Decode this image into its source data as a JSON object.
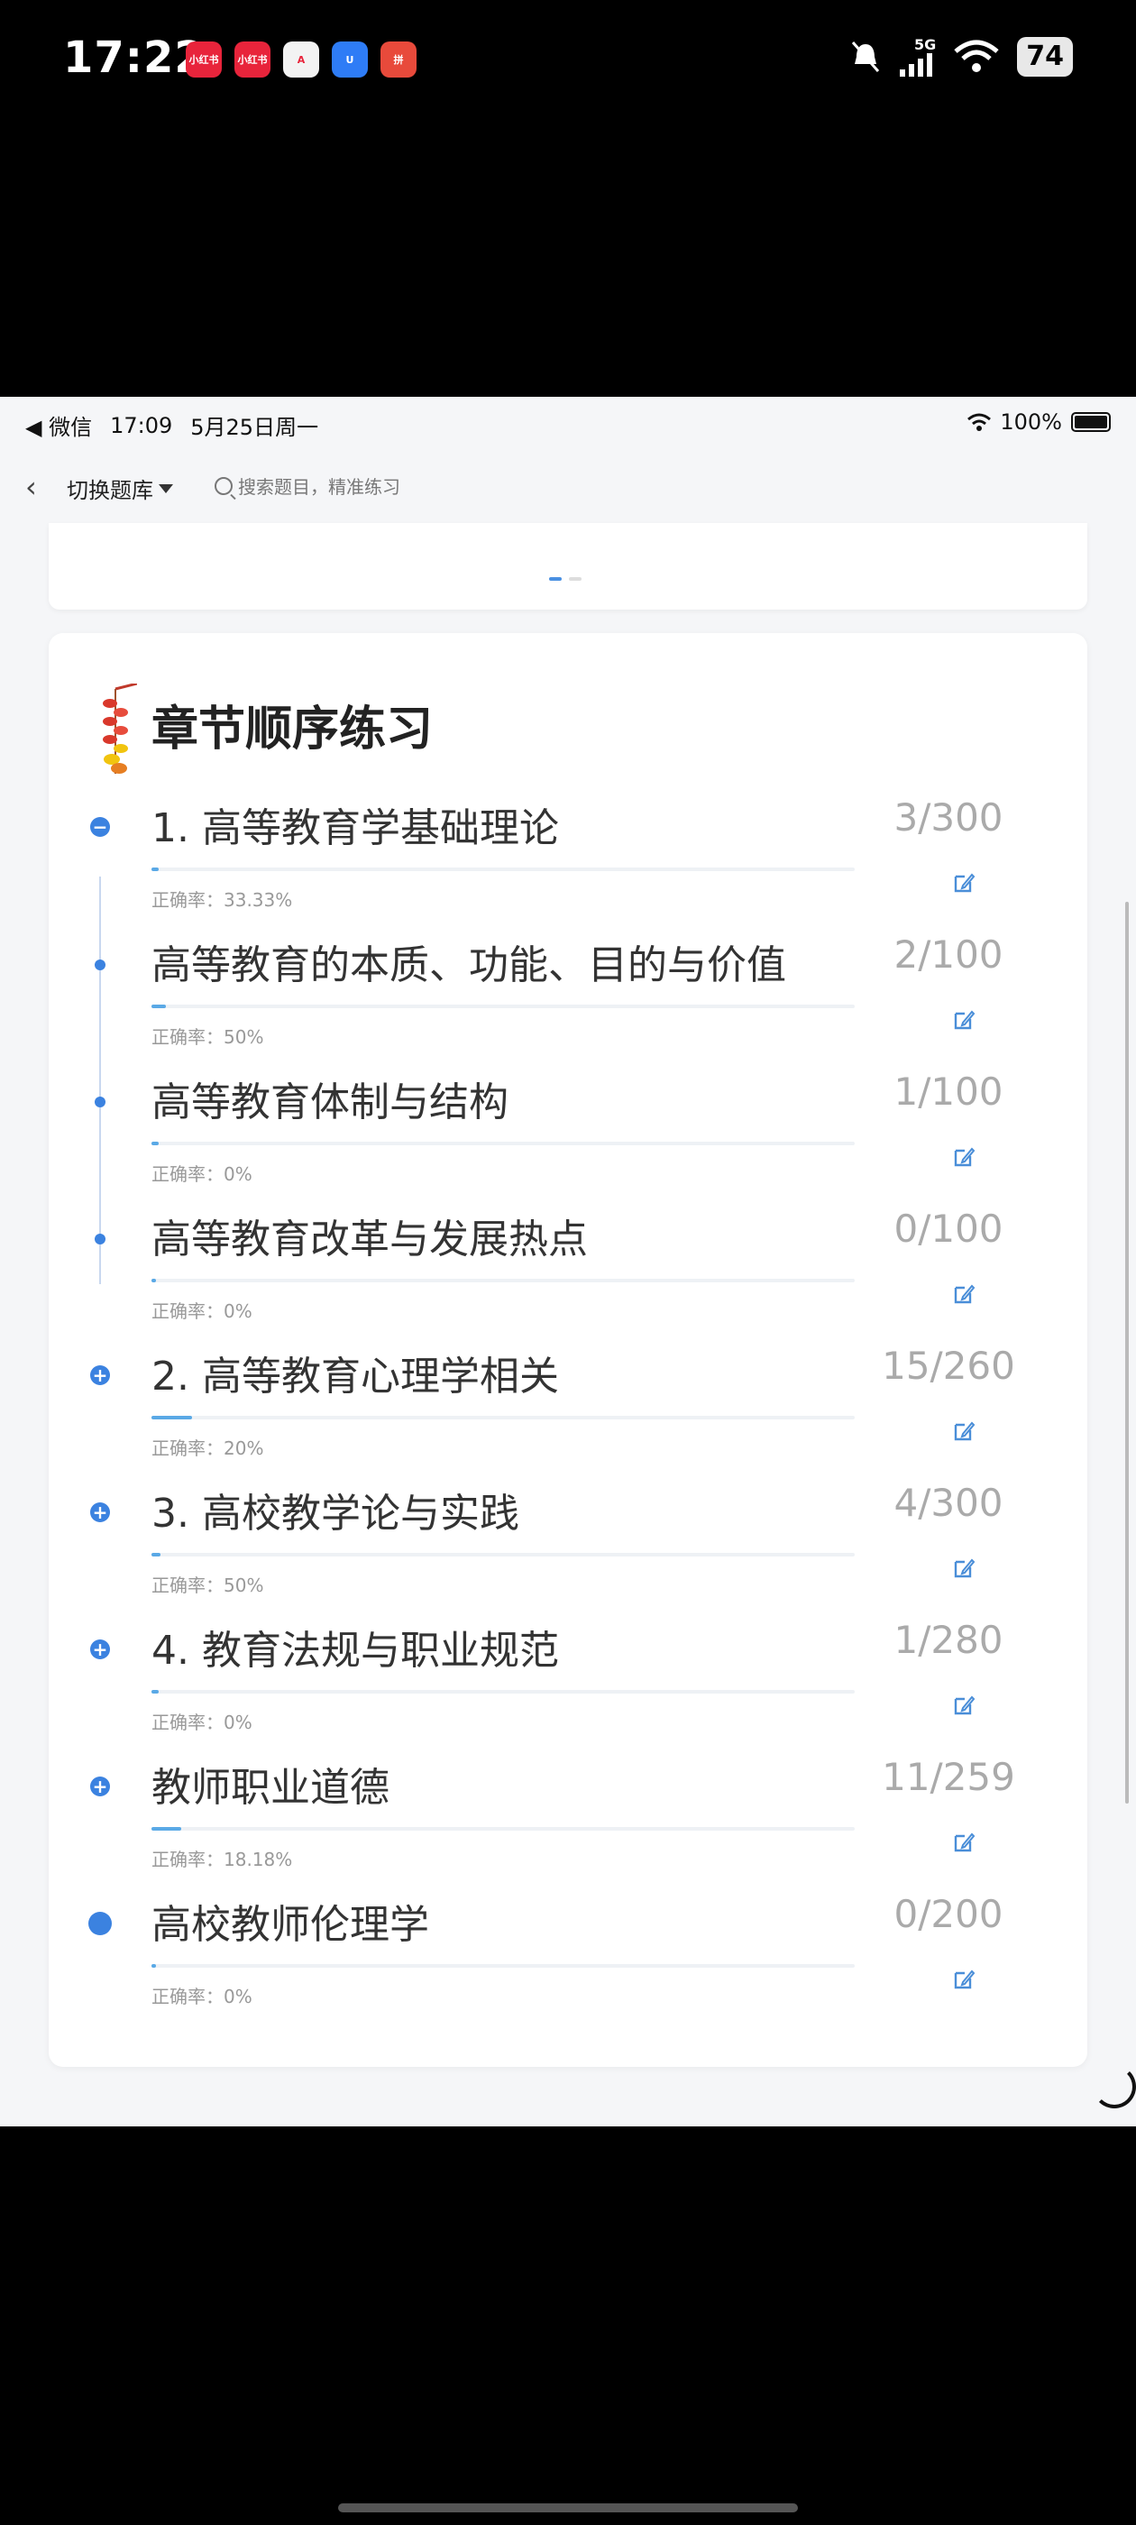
{
  "phone_status": {
    "time": "17:22",
    "battery": "74",
    "network": "5G",
    "app_icons": [
      "小红书",
      "小红书",
      "A",
      "U",
      "拼"
    ]
  },
  "inner_status": {
    "app": "◀ 微信",
    "time": "17:09",
    "date": "5月25日周一",
    "battery": "100%"
  },
  "nav": {
    "switch_label": "切换题库",
    "search_placeholder": "搜索题目，精准练习"
  },
  "section_title": "章节顺序练习",
  "accuracy_label": "正确率：",
  "chapters": [
    {
      "title": "1. 高等教育学基础理论",
      "count": "3/300",
      "accuracy": "33.33%",
      "progress": 0.01,
      "node": "minus"
    },
    {
      "title": "高等教育的本质、功能、目的与价值",
      "count": "2/100",
      "accuracy": "50%",
      "progress": 0.02,
      "node": "dot"
    },
    {
      "title": "高等教育体制与结构",
      "count": "1/100",
      "accuracy": "0%",
      "progress": 0.01,
      "node": "dot"
    },
    {
      "title": "高等教育改革与发展热点",
      "count": "0/100",
      "accuracy": "0%",
      "progress": 0.0,
      "node": "dot"
    },
    {
      "title": "2. 高等教育心理学相关",
      "count": "15/260",
      "accuracy": "20%",
      "progress": 0.058,
      "node": "plus"
    },
    {
      "title": "3. 高校教学论与实践",
      "count": "4/300",
      "accuracy": "50%",
      "progress": 0.013,
      "node": "plus"
    },
    {
      "title": "4. 教育法规与职业规范",
      "count": "1/280",
      "accuracy": "0%",
      "progress": 0.004,
      "node": "plus"
    },
    {
      "title": "教师职业道德",
      "count": "11/259",
      "accuracy": "18.18%",
      "progress": 0.042,
      "node": "plus"
    },
    {
      "title": "高校教师伦理学",
      "count": "0/200",
      "accuracy": "0%",
      "progress": 0.0,
      "node": "big"
    }
  ]
}
